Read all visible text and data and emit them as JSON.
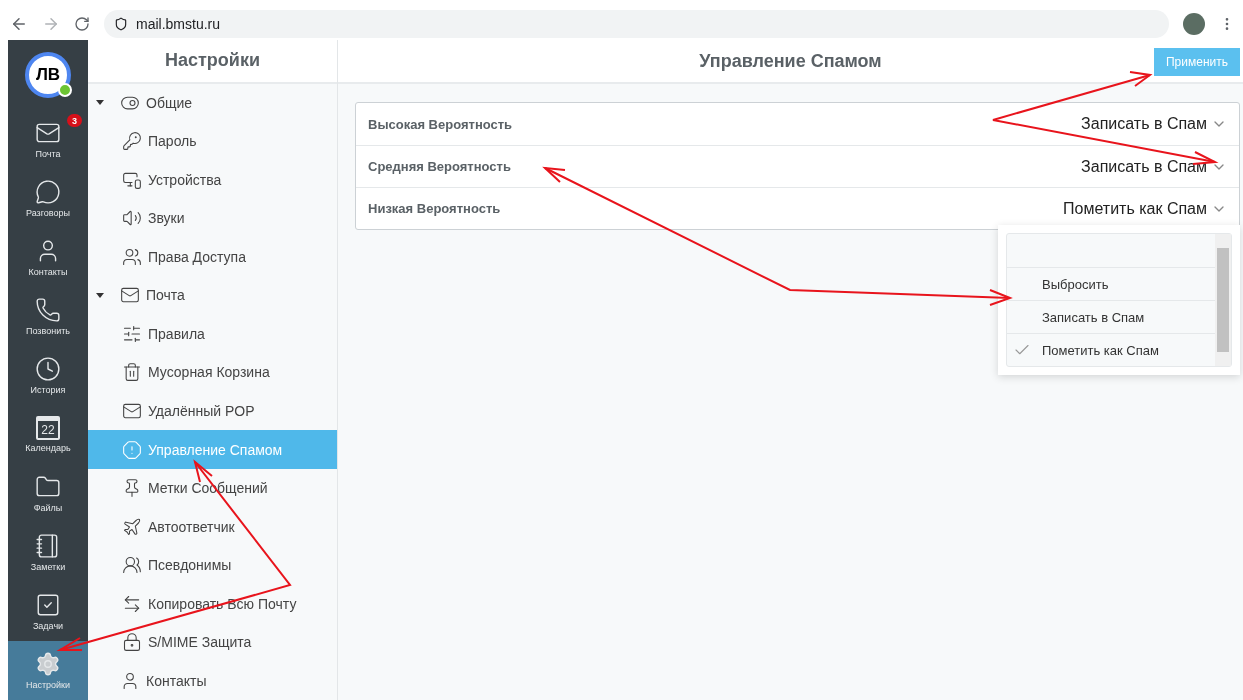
{
  "browser": {
    "url": "mail.bmstu.ru"
  },
  "rail": {
    "avatar": {
      "initials": "ЛВ",
      "online": true
    },
    "items": [
      {
        "label": "Почта",
        "badge": "3",
        "selected": false
      },
      {
        "label": "Разговоры",
        "selected": false
      },
      {
        "label": "Контакты",
        "selected": false
      },
      {
        "label": "Позвонить",
        "selected": false
      },
      {
        "label": "История",
        "selected": false
      },
      {
        "label": "Календарь",
        "date": "22",
        "selected": false
      },
      {
        "label": "Файлы",
        "selected": false
      },
      {
        "label": "Заметки",
        "selected": false
      },
      {
        "label": "Задачи",
        "selected": false
      },
      {
        "label": "Настройки",
        "selected": true
      }
    ]
  },
  "settings": {
    "title": "Настройки",
    "tree": [
      {
        "label": "Общие",
        "expanded": true,
        "selected": false,
        "children": [
          {
            "label": "Пароль",
            "selected": false
          },
          {
            "label": "Устройства",
            "selected": false
          },
          {
            "label": "Звуки",
            "selected": false
          },
          {
            "label": "Права Доступа",
            "selected": false
          }
        ]
      },
      {
        "label": "Почта",
        "expanded": true,
        "selected": false,
        "children": [
          {
            "label": "Правила",
            "selected": false
          },
          {
            "label": "Мусорная Корзина",
            "selected": false
          },
          {
            "label": "Удалённый POP",
            "selected": false
          },
          {
            "label": "Управление Спамом",
            "selected": true
          },
          {
            "label": "Метки Сообщений",
            "selected": false
          },
          {
            "label": "Автоответчик",
            "selected": false
          },
          {
            "label": "Псевдонимы",
            "selected": false
          },
          {
            "label": "Копировать Всю Почту",
            "selected": false
          },
          {
            "label": "S/MIME Защита",
            "selected": false
          }
        ]
      },
      {
        "label": "Контакты",
        "selected": false
      }
    ]
  },
  "main": {
    "title": "Управление Спамом",
    "apply_button": "Применить",
    "rows": [
      {
        "label": "Высокая Вероятность",
        "value": "Записать в Спам"
      },
      {
        "label": "Средняя Вероятность",
        "value": "Записать в Спам"
      },
      {
        "label": "Низкая Вероятность",
        "value": "Пометить как Спам"
      }
    ],
    "dropdown": {
      "options": [
        {
          "label": "Выбросить",
          "selected": false
        },
        {
          "label": "Записать в Спам",
          "selected": false
        },
        {
          "label": "Пометить как Спам",
          "selected": true
        }
      ]
    }
  }
}
